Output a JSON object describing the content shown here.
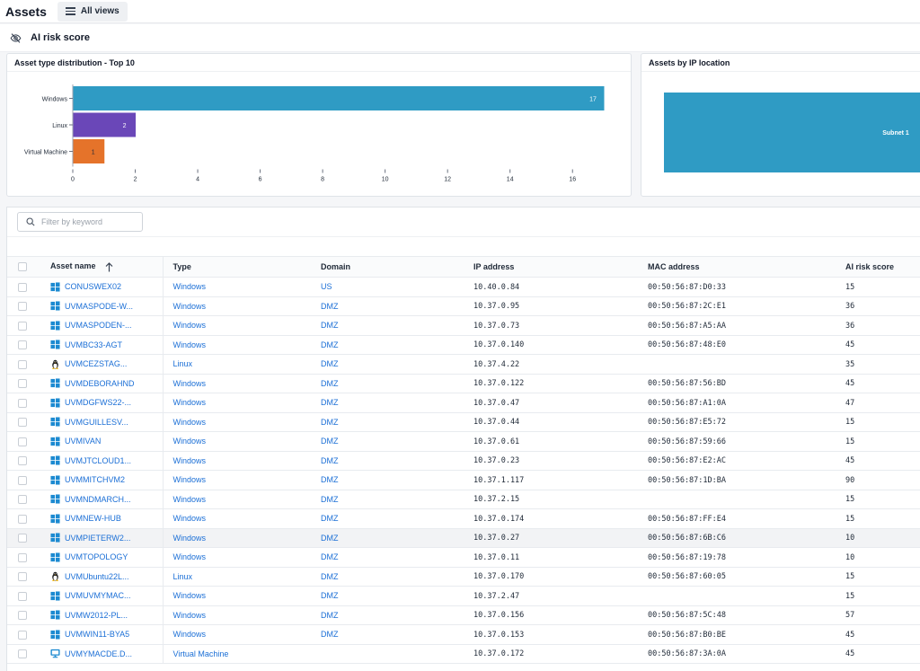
{
  "header": {
    "title": "Assets",
    "views_label": "All views"
  },
  "section": {
    "title": "AI risk score"
  },
  "colors": {
    "accent": "#1b6fd6",
    "windows_bar": "#2f9bc4",
    "linux_bar": "#6a47b8",
    "vm_bar": "#e5732a"
  },
  "asset_chart": {
    "title": "Asset type distribution - Top 10",
    "chart_data": {
      "type": "bar",
      "orientation": "horizontal",
      "categories": [
        "Windows",
        "Linux",
        "Virtual Machine"
      ],
      "values": [
        17,
        2,
        1
      ],
      "data_labels": [
        "17",
        "2",
        "1"
      ],
      "xlim": [
        0,
        17
      ],
      "xticks": [
        0,
        2,
        4,
        6,
        8,
        10,
        12,
        14,
        16
      ],
      "xtick_labels": [
        "0",
        "2",
        "4",
        "6",
        "8",
        "10",
        "12",
        "14",
        "16"
      ],
      "grid": false
    }
  },
  "ip_chart": {
    "title": "Assets by IP location",
    "chart_data": {
      "type": "treemap",
      "categories": [
        "Subnet 1"
      ],
      "values": [
        20
      ]
    }
  },
  "filter": {
    "placeholder": "Filter by keyword"
  },
  "table": {
    "columns": [
      "Asset name",
      "Type",
      "Domain",
      "IP address",
      "MAC address",
      "AI risk score"
    ],
    "rows": [
      {
        "name": "CONUSWEX02",
        "os": "windows",
        "type": "Windows",
        "domain": "US",
        "ip": "10.40.0.84",
        "mac": "00:50:56:87:D0:33",
        "risk": "15"
      },
      {
        "name": "UVMASPODE-W...",
        "os": "windows",
        "type": "Windows",
        "domain": "DMZ",
        "ip": "10.37.0.95",
        "mac": "00:50:56:87:2C:E1",
        "risk": "36"
      },
      {
        "name": "UVMASPODEN-...",
        "os": "windows",
        "type": "Windows",
        "domain": "DMZ",
        "ip": "10.37.0.73",
        "mac": "00:50:56:87:A5:AA",
        "risk": "36"
      },
      {
        "name": "UVMBC33-AGT",
        "os": "windows",
        "type": "Windows",
        "domain": "DMZ",
        "ip": "10.37.0.140",
        "mac": "00:50:56:87:48:E0",
        "risk": "45"
      },
      {
        "name": "UVMCEZSTAG...",
        "os": "linux",
        "type": "Linux",
        "domain": "DMZ",
        "ip": "10.37.4.22",
        "mac": "",
        "risk": "35"
      },
      {
        "name": "UVMDEBORAHND",
        "os": "windows",
        "type": "Windows",
        "domain": "DMZ",
        "ip": "10.37.0.122",
        "mac": "00:50:56:87:56:BD",
        "risk": "45"
      },
      {
        "name": "UVMDGFWS22-...",
        "os": "windows",
        "type": "Windows",
        "domain": "DMZ",
        "ip": "10.37.0.47",
        "mac": "00:50:56:87:A1:0A",
        "risk": "47"
      },
      {
        "name": "UVMGUILLESV...",
        "os": "windows",
        "type": "Windows",
        "domain": "DMZ",
        "ip": "10.37.0.44",
        "mac": "00:50:56:87:E5:72",
        "risk": "15"
      },
      {
        "name": "UVMIVAN",
        "os": "windows",
        "type": "Windows",
        "domain": "DMZ",
        "ip": "10.37.0.61",
        "mac": "00:50:56:87:59:66",
        "risk": "15"
      },
      {
        "name": "UVMJTCLOUD1...",
        "os": "windows",
        "type": "Windows",
        "domain": "DMZ",
        "ip": "10.37.0.23",
        "mac": "00:50:56:87:E2:AC",
        "risk": "45"
      },
      {
        "name": "UVMMITCHVM2",
        "os": "windows",
        "type": "Windows",
        "domain": "DMZ",
        "ip": "10.37.1.117",
        "mac": "00:50:56:87:1D:BA",
        "risk": "90"
      },
      {
        "name": "UVMNDMARCH...",
        "os": "windows",
        "type": "Windows",
        "domain": "DMZ",
        "ip": "10.37.2.15",
        "mac": "",
        "risk": "15"
      },
      {
        "name": "UVMNEW-HUB",
        "os": "windows",
        "type": "Windows",
        "domain": "DMZ",
        "ip": "10.37.0.174",
        "mac": "00:50:56:87:FF:E4",
        "risk": "15"
      },
      {
        "name": "UVMPIETERW2...",
        "os": "windows",
        "type": "Windows",
        "domain": "DMZ",
        "ip": "10.37.0.27",
        "mac": "00:50:56:87:6B:C6",
        "risk": "10"
      },
      {
        "name": "UVMTOPOLOGY",
        "os": "windows",
        "type": "Windows",
        "domain": "DMZ",
        "ip": "10.37.0.11",
        "mac": "00:50:56:87:19:78",
        "risk": "10"
      },
      {
        "name": "UVMUbuntu22L...",
        "os": "linux",
        "type": "Linux",
        "domain": "DMZ",
        "ip": "10.37.0.170",
        "mac": "00:50:56:87:60:05",
        "risk": "15"
      },
      {
        "name": "UVMUVMYMAC...",
        "os": "windows",
        "type": "Windows",
        "domain": "DMZ",
        "ip": "10.37.2.47",
        "mac": "",
        "risk": "15"
      },
      {
        "name": "UVMW2012-PL...",
        "os": "windows",
        "type": "Windows",
        "domain": "DMZ",
        "ip": "10.37.0.156",
        "mac": "00:50:56:87:5C:48",
        "risk": "57"
      },
      {
        "name": "UVMWIN11-BYA5",
        "os": "windows",
        "type": "Windows",
        "domain": "DMZ",
        "ip": "10.37.0.153",
        "mac": "00:50:56:87:B0:BE",
        "risk": "45"
      },
      {
        "name": "UVMYMACDE.D...",
        "os": "vm",
        "type": "Virtual Machine",
        "domain": "",
        "ip": "10.37.0.172",
        "mac": "00:50:56:87:3A:0A",
        "risk": "45"
      }
    ]
  }
}
